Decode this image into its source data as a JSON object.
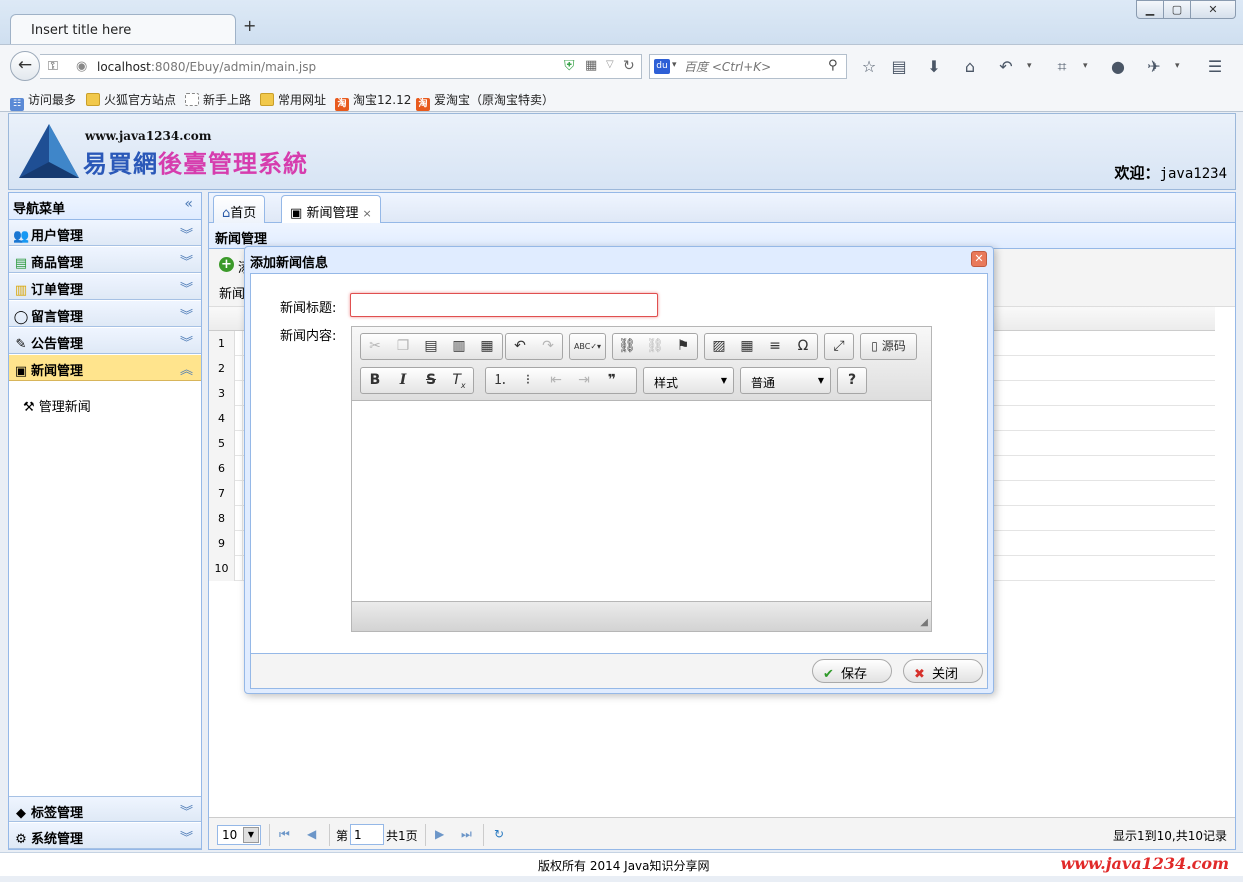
{
  "browser": {
    "tab_title": "Insert title here",
    "new_tab": "+",
    "url_host": "localhost",
    "url_path": ":8080/Ebuy/admin/main.jsp",
    "search_placeholder": "百度 <Ctrl+K>",
    "search_engine": "du",
    "bookmarks": [
      {
        "label": "访问最多",
        "icon": "often"
      },
      {
        "label": "火狐官方站点",
        "icon": "folder"
      },
      {
        "label": "新手上路",
        "icon": "blank"
      },
      {
        "label": "常用网址",
        "icon": "folder"
      },
      {
        "label": "淘宝12.12",
        "icon": "taobao"
      },
      {
        "label": "爱淘宝（原淘宝特卖）",
        "icon": "taobao"
      }
    ],
    "taobao_glyph": "淘"
  },
  "header": {
    "logo_url": "www.java1234.com",
    "logo_title_a": "易買網",
    "logo_title_b": "後臺管理系統",
    "welcome_label": "欢迎：",
    "welcome_user": "java1234"
  },
  "sidebar": {
    "title": "导航菜单",
    "items": [
      {
        "label": "用户管理",
        "icon": "users-icon"
      },
      {
        "label": "商品管理",
        "icon": "product-icon"
      },
      {
        "label": "订单管理",
        "icon": "order-icon"
      },
      {
        "label": "留言管理",
        "icon": "message-icon"
      },
      {
        "label": "公告管理",
        "icon": "notice-icon"
      },
      {
        "label": "新闻管理",
        "icon": "news-icon"
      }
    ],
    "sub_item": "管理新闻",
    "bottom_items": [
      {
        "label": "标签管理",
        "icon": "tag-icon"
      },
      {
        "label": "系统管理",
        "icon": "settings-icon"
      }
    ]
  },
  "main": {
    "tabs": [
      {
        "label": "首页"
      },
      {
        "label": "新闻管理"
      }
    ],
    "panel_title": "新闻管理",
    "add_label": "添",
    "search_label": "新闻",
    "rows": [
      "1",
      "2",
      "3",
      "4",
      "5",
      "6",
      "7",
      "8",
      "9",
      "10"
    ],
    "pager": {
      "page_size": "10",
      "di": "第",
      "page": "1",
      "total": "共1页",
      "info": "显示1到10,共10记录"
    }
  },
  "dialog": {
    "title": "添加新闻信息",
    "title_label": "新闻标题:",
    "title_value": "",
    "content_label": "新闻内容:",
    "editor": {
      "abc": "ABC",
      "source_label": "源码",
      "style_label": "样式",
      "format_label": "普通",
      "help": "?"
    },
    "save_label": "保存",
    "close_label": "关闭"
  },
  "footer": {
    "copyright": "版权所有 2014 Java知识分享网",
    "watermark": "www.java1234.com"
  }
}
